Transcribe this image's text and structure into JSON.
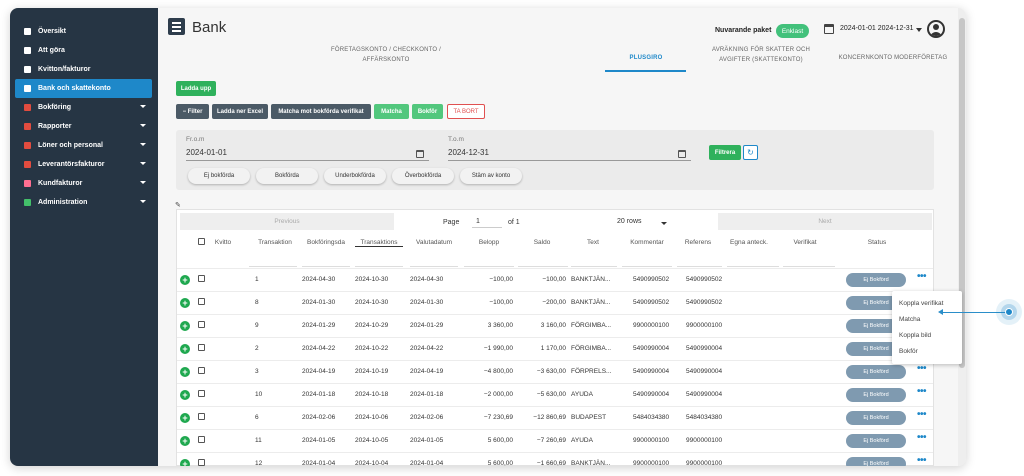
{
  "sidebar": {
    "items": [
      {
        "label": "Översikt",
        "icon": "home-icon",
        "color": "#ffffff",
        "caret": false,
        "active": false
      },
      {
        "label": "Att göra",
        "icon": "checklist-icon",
        "color": "#ffffff",
        "caret": false,
        "active": false
      },
      {
        "label": "Kvitton/fakturor",
        "icon": "receipt-icon",
        "color": "#ffffff",
        "caret": false,
        "active": false
      },
      {
        "label": "Bank och skattekonto",
        "icon": "bank-icon",
        "color": "#ffffff",
        "caret": false,
        "active": true
      },
      {
        "label": "Bokföring",
        "icon": "ledger-icon",
        "color": "#e24c3f",
        "caret": true,
        "active": false
      },
      {
        "label": "Rapporter",
        "icon": "report-icon",
        "color": "#e24c3f",
        "caret": true,
        "active": false
      },
      {
        "label": "Löner och personal",
        "icon": "payroll-icon",
        "color": "#e24c3f",
        "caret": true,
        "active": false
      },
      {
        "label": "Leverantörsfakturor",
        "icon": "supplier-icon",
        "color": "#e24c3f",
        "caret": true,
        "active": false
      },
      {
        "label": "Kundfakturor",
        "icon": "customer-icon",
        "color": "#ff6f91",
        "caret": true,
        "active": false
      },
      {
        "label": "Administration",
        "icon": "admin-icon",
        "color": "#43c06a",
        "caret": true,
        "active": false
      }
    ]
  },
  "header": {
    "title": "Bank",
    "package_label": "Nuvarande paket",
    "package_badge": "Enklast",
    "date_range": "2024-01-01 2024-12-31"
  },
  "tabs": [
    {
      "label": "FÖRETAGSKONTO / CHECKKONTO /\nAFFÄRSKONTO",
      "active": false
    },
    {
      "label": "PLUSGIRO",
      "active": true
    },
    {
      "label": "AVRÄKNING FÖR SKATTER OCH\nAVGIFTER (SKATTEKONTO)",
      "active": false
    },
    {
      "label": "KONCERNKONTO MODERFÖRETAG",
      "active": false
    }
  ],
  "actions": {
    "upload": "Ladda upp",
    "filter": "Filter",
    "excel": "Ladda ner Excel",
    "match_verif": "Matcha mot bokförda verifikat",
    "match": "Matcha",
    "book": "Bokför",
    "delete": "TA BORT"
  },
  "filters": {
    "from_label": "Fr.o.m",
    "from_value": "2024-01-01",
    "to_label": "T.o.m",
    "to_value": "2024-12-31",
    "apply": "Filtrera",
    "chips": [
      "Ej bokförda",
      "Bokförda",
      "Underbokförda",
      "Överbokförda",
      "Stäm av konto"
    ]
  },
  "pager": {
    "prev": "Previous",
    "page_label": "Page",
    "page": "1",
    "of_label": "of 1",
    "rows": "20 rows",
    "next": "Next"
  },
  "columns": [
    "Kvitto",
    "Transaktion",
    "Bokföringsda",
    "Transaktions",
    "Valutadatum",
    "Belopp",
    "Saldo",
    "Text",
    "Kommentar",
    "Referens",
    "Egna anteck.",
    "Verifikat",
    "Status"
  ],
  "rows": [
    {
      "nr": "1",
      "bok": "2024-04-30",
      "trans": "2024-10-30",
      "valuta": "2024-04-30",
      "belopp": "−100,00",
      "saldo": "−100,00",
      "text": "BANKTJÄN...",
      "komm": "5490990502",
      "ref": "5490990502",
      "status": "Ej Bokförd"
    },
    {
      "nr": "8",
      "bok": "2024-01-30",
      "trans": "2024-10-30",
      "valuta": "2024-01-30",
      "belopp": "−100,00",
      "saldo": "−200,00",
      "text": "BANKTJÄN...",
      "komm": "5490990502",
      "ref": "5490990502",
      "status": "Ej Bokförd"
    },
    {
      "nr": "9",
      "bok": "2024-01-29",
      "trans": "2024-10-29",
      "valuta": "2024-01-29",
      "belopp": "3 360,00",
      "saldo": "3 160,00",
      "text": "FÖRGIMBA...",
      "komm": "9900000100",
      "ref": "9900000100",
      "status": "Ej Bokförd"
    },
    {
      "nr": "2",
      "bok": "2024-04-22",
      "trans": "2024-10-22",
      "valuta": "2024-04-22",
      "belopp": "−1 990,00",
      "saldo": "1 170,00",
      "text": "FÖRGIMBA...",
      "komm": "5490990004",
      "ref": "5490990004",
      "status": "Ej Bokförd"
    },
    {
      "nr": "3",
      "bok": "2024-04-19",
      "trans": "2024-10-19",
      "valuta": "2024-04-19",
      "belopp": "−4 800,00",
      "saldo": "−3 630,00",
      "text": "FÖRPRELS...",
      "komm": "5490990004",
      "ref": "5490990004",
      "status": "Ej Bokförd"
    },
    {
      "nr": "10",
      "bok": "2024-01-18",
      "trans": "2024-10-18",
      "valuta": "2024-01-18",
      "belopp": "−2 000,00",
      "saldo": "−5 630,00",
      "text": "AYUDA",
      "komm": "5490990004",
      "ref": "5490990004",
      "status": "Ej Bokförd"
    },
    {
      "nr": "6",
      "bok": "2024-02-06",
      "trans": "2024-10-06",
      "valuta": "2024-02-06",
      "belopp": "−7 230,69",
      "saldo": "−12 860,69",
      "text": "BUDAPEST",
      "komm": "5484034380",
      "ref": "5484034380",
      "status": "Ej Bokförd"
    },
    {
      "nr": "11",
      "bok": "2024-01-05",
      "trans": "2024-10-05",
      "valuta": "2024-01-05",
      "belopp": "5 600,00",
      "saldo": "−7 260,69",
      "text": "AYUDA",
      "komm": "9900000100",
      "ref": "9900000100",
      "status": "Ej Bokförd"
    },
    {
      "nr": "12",
      "bok": "2024-01-04",
      "trans": "2024-10-04",
      "valuta": "2024-01-04",
      "belopp": "5 600,00",
      "saldo": "−1 660,69",
      "text": "BANKTJÄN...",
      "komm": "9900000100",
      "ref": "9900000100",
      "status": "Ej Bokförd"
    }
  ],
  "context_menu": [
    "Koppla verifikat",
    "Matcha",
    "Koppla bild",
    "Bokför"
  ],
  "colors": {
    "sidebar_bg": "#263544",
    "accent": "#1e88c9",
    "green": "#2fb15c",
    "status": "#7f9ab0"
  }
}
